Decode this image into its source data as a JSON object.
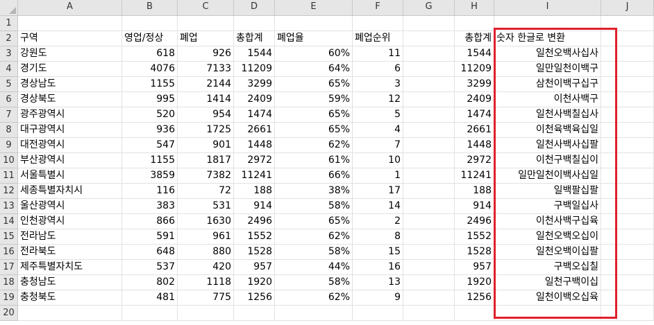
{
  "accent_color": "#e0202a",
  "columns": [
    "A",
    "B",
    "C",
    "D",
    "E",
    "F",
    "G",
    "H",
    "I",
    "J"
  ],
  "rows": [
    "1",
    "2",
    "3",
    "4",
    "5",
    "6",
    "7",
    "8",
    "9",
    "10",
    "11",
    "12",
    "13",
    "14",
    "15",
    "16",
    "17",
    "18",
    "19",
    "20"
  ],
  "headers": {
    "region": "구역",
    "active": "영업/정상",
    "closed": "폐업",
    "total": "총합계",
    "closure_rate": "폐업율",
    "closure_rank": "폐업순위",
    "total2": "총합계",
    "korean": "숫자 한글로 변환"
  },
  "table": [
    {
      "region": "강원도",
      "active": "618",
      "closed": "926",
      "total": "1544",
      "rate": "60%",
      "rank": "11",
      "total2": "1544",
      "korean": "일천오백사십사"
    },
    {
      "region": "경기도",
      "active": "4076",
      "closed": "7133",
      "total": "11209",
      "rate": "64%",
      "rank": "6",
      "total2": "11209",
      "korean": "일만일천이백구"
    },
    {
      "region": "경상남도",
      "active": "1155",
      "closed": "2144",
      "total": "3299",
      "rate": "65%",
      "rank": "3",
      "total2": "3299",
      "korean": "삼천이백구십구"
    },
    {
      "region": "경상북도",
      "active": "995",
      "closed": "1414",
      "total": "2409",
      "rate": "59%",
      "rank": "12",
      "total2": "2409",
      "korean": "이천사백구"
    },
    {
      "region": "광주광역시",
      "active": "520",
      "closed": "954",
      "total": "1474",
      "rate": "65%",
      "rank": "5",
      "total2": "1474",
      "korean": "일천사백칠십사"
    },
    {
      "region": "대구광역시",
      "active": "936",
      "closed": "1725",
      "total": "2661",
      "rate": "65%",
      "rank": "4",
      "total2": "2661",
      "korean": "이천육백육십일"
    },
    {
      "region": "대전광역시",
      "active": "547",
      "closed": "901",
      "total": "1448",
      "rate": "62%",
      "rank": "7",
      "total2": "1448",
      "korean": "일천사백사십팔"
    },
    {
      "region": "부산광역시",
      "active": "1155",
      "closed": "1817",
      "total": "2972",
      "rate": "61%",
      "rank": "10",
      "total2": "2972",
      "korean": "이천구백칠십이"
    },
    {
      "region": "서울특별시",
      "active": "3859",
      "closed": "7382",
      "total": "11241",
      "rate": "66%",
      "rank": "1",
      "total2": "11241",
      "korean": "일만일천이백사십일"
    },
    {
      "region": "세종특별자치시",
      "active": "116",
      "closed": "72",
      "total": "188",
      "rate": "38%",
      "rank": "17",
      "total2": "188",
      "korean": "일백팔십팔"
    },
    {
      "region": "울산광역시",
      "active": "383",
      "closed": "531",
      "total": "914",
      "rate": "58%",
      "rank": "14",
      "total2": "914",
      "korean": "구백일십사"
    },
    {
      "region": "인천광역시",
      "active": "866",
      "closed": "1630",
      "total": "2496",
      "rate": "65%",
      "rank": "2",
      "total2": "2496",
      "korean": "이천사백구십육"
    },
    {
      "region": "전라남도",
      "active": "591",
      "closed": "961",
      "total": "1552",
      "rate": "62%",
      "rank": "8",
      "total2": "1552",
      "korean": "일천오백오십이"
    },
    {
      "region": "전라북도",
      "active": "648",
      "closed": "880",
      "total": "1528",
      "rate": "58%",
      "rank": "15",
      "total2": "1528",
      "korean": "일천오백이십팔"
    },
    {
      "region": "제주특별자치도",
      "active": "537",
      "closed": "420",
      "total": "957",
      "rate": "44%",
      "rank": "16",
      "total2": "957",
      "korean": "구백오십칠"
    },
    {
      "region": "충청남도",
      "active": "802",
      "closed": "1118",
      "total": "1920",
      "rate": "58%",
      "rank": "13",
      "total2": "1920",
      "korean": "일천구백이십"
    },
    {
      "region": "충청북도",
      "active": "481",
      "closed": "775",
      "total": "1256",
      "rate": "62%",
      "rank": "9",
      "total2": "1256",
      "korean": "일천이백오십육"
    }
  ]
}
